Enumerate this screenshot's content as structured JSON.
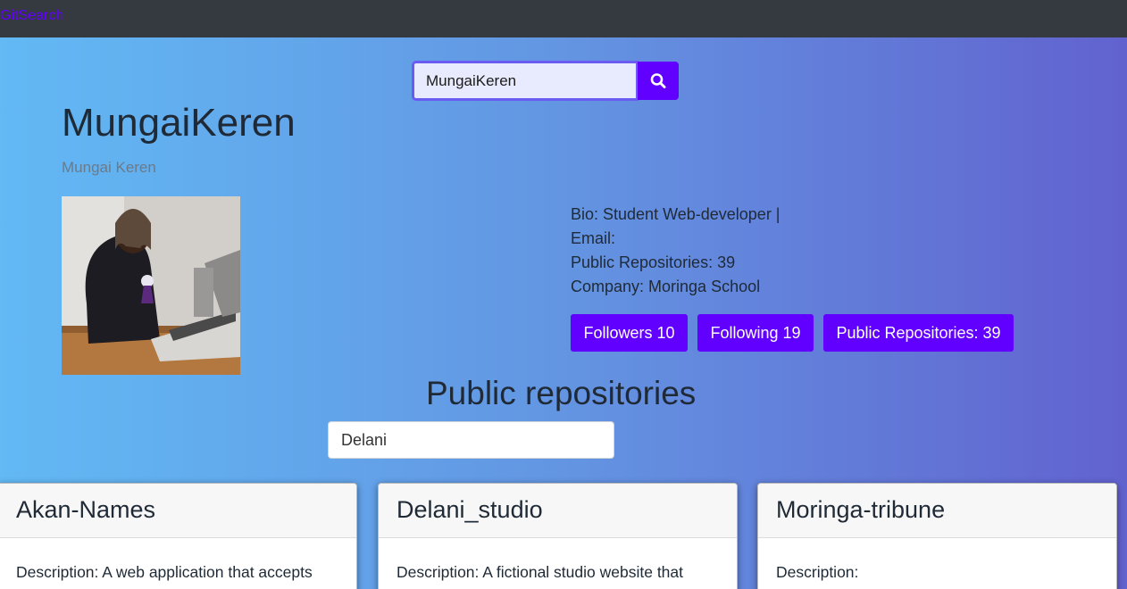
{
  "navbar": {
    "brand": "GitSearch"
  },
  "search": {
    "value": "MungaiKeren"
  },
  "profile": {
    "username": "MungaiKeren",
    "name": "Mungai Keren",
    "bio": "Bio: Student Web-developer |",
    "email": "Email:",
    "public_repos": "Public Repositories: 39",
    "company": "Company: Moringa School"
  },
  "stats": {
    "followers": "Followers 10",
    "following": "Following 19",
    "public_repos": "Public Repositories: 39"
  },
  "repos": {
    "heading": "Public repositories",
    "filter_value": "Delani",
    "items": [
      {
        "name": "Akan-Names",
        "description": "Description: A web application that accepts"
      },
      {
        "name": "Delani_studio",
        "description": "Description: A fictional studio website that"
      },
      {
        "name": "Moringa-tribune",
        "description": "Description:"
      }
    ]
  },
  "colors": {
    "accent": "#6200ff",
    "navbar": "#343a40"
  }
}
